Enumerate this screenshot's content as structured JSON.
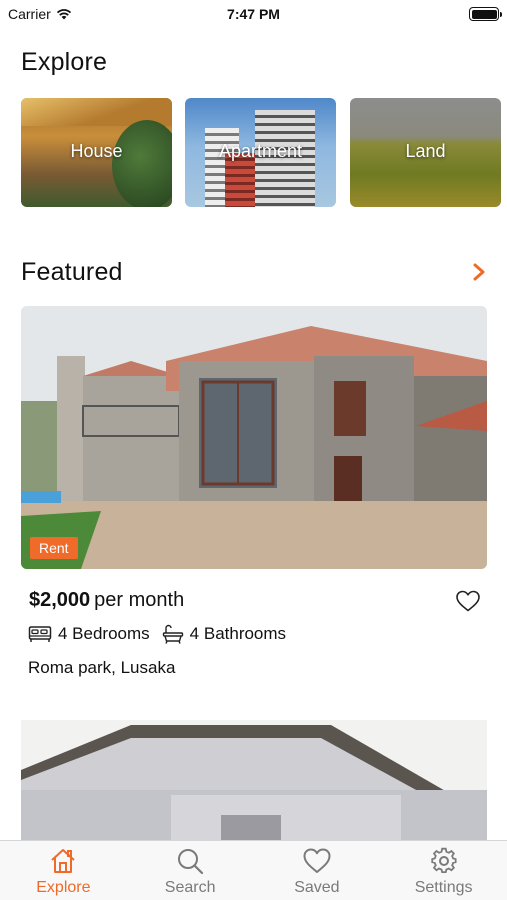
{
  "status_bar": {
    "carrier": "Carrier",
    "time": "7:47 PM",
    "battery_level": 1.0
  },
  "explore": {
    "title": "Explore",
    "categories": [
      {
        "label": "House"
      },
      {
        "label": "Apartment"
      },
      {
        "label": "Land"
      }
    ]
  },
  "featured": {
    "title": "Featured",
    "listing": {
      "badge": "Rent",
      "price": "$2,000",
      "period": "per month",
      "bedrooms": "4 Bedrooms",
      "bathrooms": "4 Bathrooms",
      "location": "Roma park, Lusaka",
      "favorited": false
    }
  },
  "tabs": [
    {
      "label": "Explore",
      "icon": "home-icon",
      "active": true
    },
    {
      "label": "Search",
      "icon": "search-icon",
      "active": false
    },
    {
      "label": "Saved",
      "icon": "heart-icon",
      "active": false
    },
    {
      "label": "Settings",
      "icon": "gear-icon",
      "active": false
    }
  ],
  "colors": {
    "accent": "#f06a2a",
    "tab_inactive": "#7a7a7a",
    "tab_bar_bg": "#f8f8f8"
  }
}
